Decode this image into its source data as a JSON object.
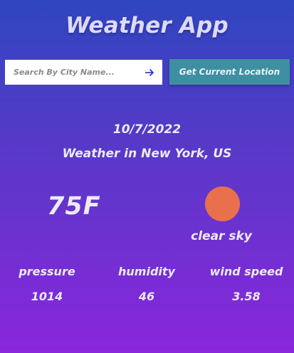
{
  "app": {
    "title": "Weather App"
  },
  "search": {
    "placeholder": "Search By City Name...",
    "value": "",
    "submit_icon": "arrow-right-icon"
  },
  "location_button": {
    "label": "Get Current Location"
  },
  "weather": {
    "date": "10/7/2022",
    "location_heading": "Weather in New York, US",
    "temperature": "75F",
    "icon": "clear-sky-sun-icon",
    "icon_color": "#e9704d",
    "description": "clear sky"
  },
  "stats": [
    {
      "label": "pressure",
      "value": "1014"
    },
    {
      "label": "humidity",
      "value": "46"
    },
    {
      "label": "wind speed",
      "value": "3.58"
    }
  ],
  "colors": {
    "background_top": "#2f46c0",
    "background_bottom": "#8a26dc",
    "button": "#3f8fa3",
    "search_arrow": "#2a2ad8"
  }
}
